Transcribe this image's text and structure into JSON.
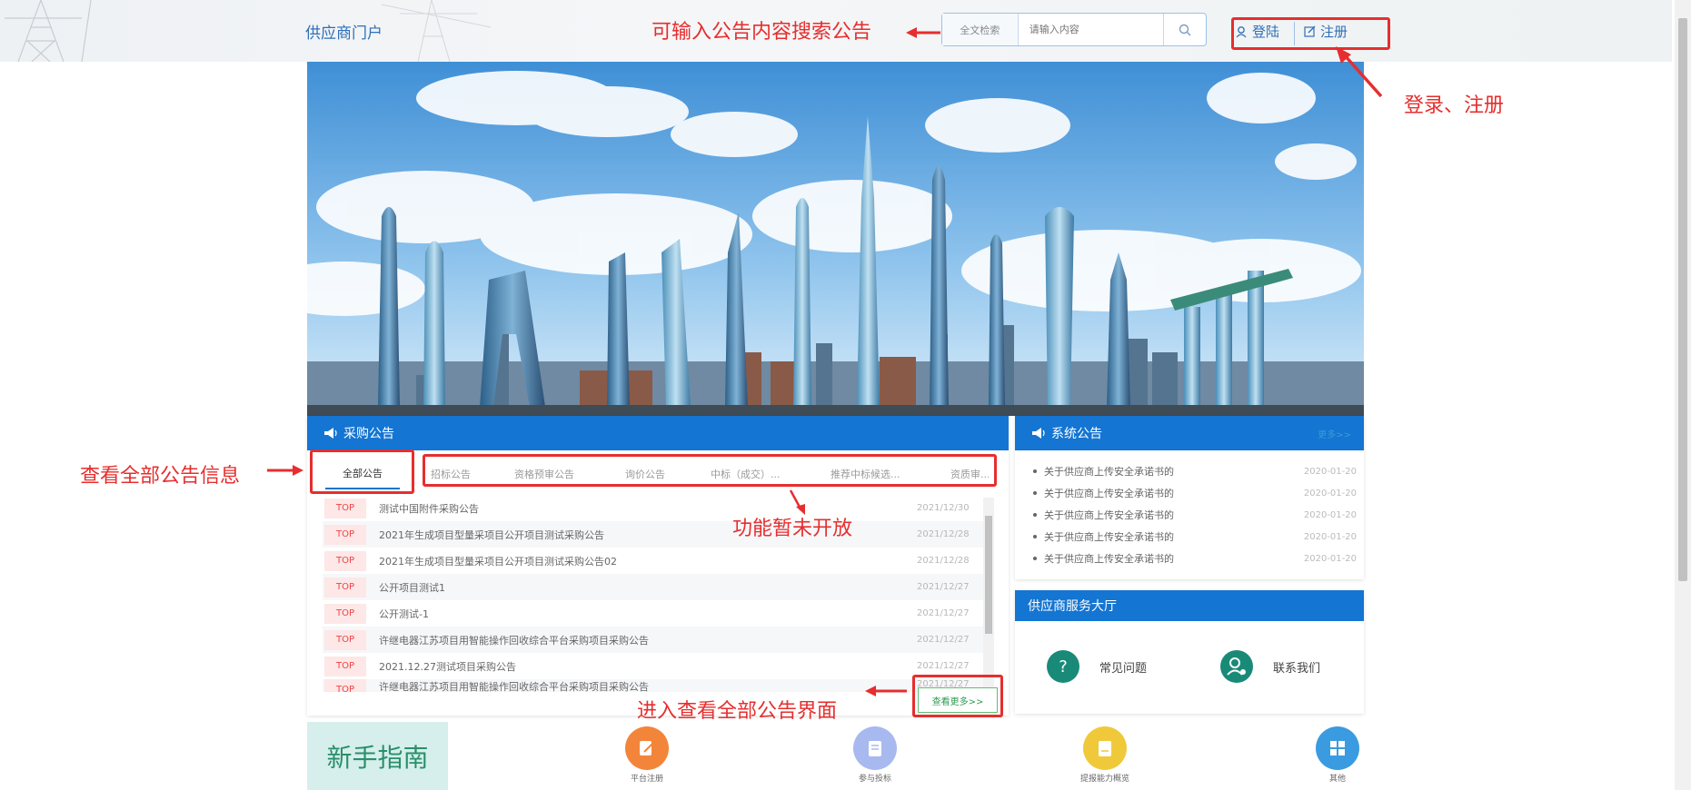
{
  "header": {
    "portal_title": "供应商门户",
    "search_type": "全文检索",
    "search_placeholder": "请输入内容",
    "login_label": "登陆",
    "register_label": "注册"
  },
  "annotations": {
    "search_hint": "可输入公告内容搜索公告",
    "login_hint": "登录、注册",
    "all_notices_hint": "查看全部公告信息",
    "not_open_hint": "功能暂未开放",
    "view_all_hint": "进入查看全部公告界面"
  },
  "procurement": {
    "title": "采购公告",
    "tabs": [
      "全部公告",
      "招标公告",
      "资格预审公告",
      "询价公告",
      "中标（成交）...",
      "推荐中标候选...",
      "资质审..."
    ],
    "rows": [
      {
        "tag": "TOP",
        "title": "测试中国附件采购公告",
        "date": "2021/12/30"
      },
      {
        "tag": "TOP",
        "title": "2021年生成项目型量采项目公开项目测试采购公告",
        "date": "2021/12/28"
      },
      {
        "tag": "TOP",
        "title": "2021年生成项目型量采项目公开项目测试采购公告02",
        "date": "2021/12/28"
      },
      {
        "tag": "TOP",
        "title": "公开项目测试1",
        "date": "2021/12/27"
      },
      {
        "tag": "TOP",
        "title": "公开测试-1",
        "date": "2021/12/27"
      },
      {
        "tag": "TOP",
        "title": "许继电器江苏项目用智能操作回收综合平台采购项目采购公告",
        "date": "2021/12/27"
      },
      {
        "tag": "TOP",
        "title": "2021.12.27测试项目采购公告",
        "date": "2021/12/27"
      },
      {
        "tag": "TOP",
        "title": "许继电器江苏项目用智能操作回收综合平台采购项目采购公告",
        "date": "2021/12/27"
      }
    ],
    "view_all": "查看更多>>"
  },
  "system_notices": {
    "title": "系统公告",
    "more": "更多>>",
    "items": [
      {
        "title": "关于供应商上传安全承诺书的",
        "date": "2020-01-20"
      },
      {
        "title": "关于供应商上传安全承诺书的",
        "date": "2020-01-20"
      },
      {
        "title": "关于供应商上传安全承诺书的",
        "date": "2020-01-20"
      },
      {
        "title": "关于供应商上传安全承诺书的",
        "date": "2020-01-20"
      },
      {
        "title": "关于供应商上传安全承诺书的",
        "date": "2020-01-20"
      }
    ]
  },
  "service_hall": {
    "title": "供应商服务大厅",
    "faq": "常见问题",
    "contact": "联系我们"
  },
  "guide": {
    "title": "新手指南",
    "items": [
      "平台注册",
      "参与投标",
      "提报能力概览",
      "其他"
    ]
  },
  "colors": {
    "accent": "#1475d2",
    "annotation": "#e62e2e",
    "service_icon": "#1a8a78",
    "guide_bg": "#d6efec"
  }
}
